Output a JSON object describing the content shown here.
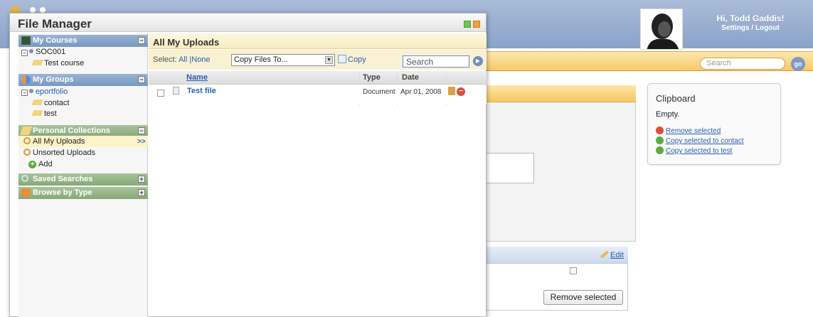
{
  "app": {
    "greeting": "Hi, Todd Gaddis!",
    "settings_label": "Settings",
    "separator": "/",
    "logout_label": "Logout",
    "search_placeholder": "Search",
    "go_label": "go",
    "edit_label": "Edit",
    "remove_selected_button": "Remove selected"
  },
  "clipboard": {
    "title": "Clipboard",
    "status": "Empty.",
    "actions": [
      {
        "label": "Remove selected",
        "icon": "remove-icon",
        "color": "#e04a3c"
      },
      {
        "label": "Copy selected to contact",
        "icon": "add-icon",
        "color": "#5faa43"
      },
      {
        "label": "Copy selected to test",
        "icon": "add-icon",
        "color": "#5faa43"
      }
    ]
  },
  "file_manager": {
    "title": "File Manager",
    "sections": {
      "my_courses": {
        "label": "My Courses",
        "toggle": "−",
        "items": [
          "SOC001",
          "Test course"
        ]
      },
      "my_groups": {
        "label": "My Groups",
        "toggle": "−",
        "items": [
          "eportfolio",
          "contact",
          "test"
        ]
      },
      "personal_collections": {
        "label": "Personal Collections",
        "toggle": "−",
        "items": [
          "All My Uploads",
          "Unsorted Uploads",
          "Add"
        ],
        "active_marker": ">>"
      },
      "saved_searches": {
        "label": "Saved Searches",
        "toggle": "+"
      },
      "browse_by_type": {
        "label": "Browse by Type",
        "toggle": "+"
      }
    },
    "main": {
      "title": "All My Uploads",
      "select_label": "Select:",
      "select_all": "All",
      "select_sep": "|",
      "select_none": "None",
      "copy_files_to": "Copy Files To...",
      "copy_button": "Copy",
      "search_placeholder": "Search",
      "columns": [
        "Name",
        "Type",
        "Date"
      ],
      "rows": [
        {
          "name": "Test file",
          "type": "Document",
          "date": "Apr 01, 2008"
        }
      ]
    }
  },
  "colors": {
    "header_blue": "#8aa3c8",
    "accent_orange": "#f6c866",
    "link_blue": "#2a5db0"
  }
}
